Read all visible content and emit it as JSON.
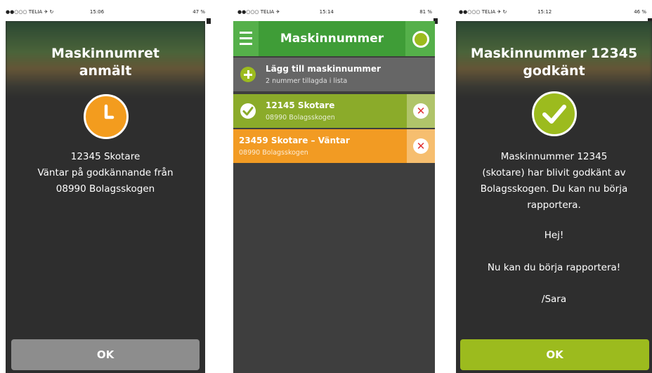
{
  "screens": [
    {
      "status": {
        "carrier": "●●○○○ TELIA ✈ ↻",
        "time": "15:06",
        "battery": "47 %"
      },
      "title_line1": "Maskinnumret",
      "title_line2": "anmält",
      "icon": "clock-icon",
      "lines": [
        "12345 Skotare",
        "Väntar på godkännande från",
        "08990 Bolagsskogen"
      ],
      "button": "OK"
    },
    {
      "status": {
        "carrier": "●●○○○ TELIA ✈",
        "time": "15:14",
        "battery": "81 %"
      },
      "header_title": "Maskinnummer",
      "add_row": {
        "title": "Lägg till maskinnummer",
        "subtitle": "2 nummer tillagda i lista"
      },
      "items": [
        {
          "title": "12145 Skotare",
          "subtitle": "08990 Bolagsskogen",
          "state": "approved"
        },
        {
          "title": "23459 Skotare – Väntar",
          "subtitle": "08990 Bolagsskogen",
          "state": "waiting"
        }
      ]
    },
    {
      "status": {
        "carrier": "●●○○○ TELIA ✈ ↻",
        "time": "15:12",
        "battery": "46 %"
      },
      "title_line1": "Maskinnummer 12345",
      "title_line2": "godkänt",
      "icon": "check-icon",
      "lines": [
        "Maskinnummer 12345",
        "(skotare) har blivit godkänt av",
        "Bolagsskogen. Du kan nu börja",
        "rapportera."
      ],
      "greeting": "Hej!",
      "message": "Nu kan du börja rapportera!",
      "signature": "/Sara",
      "button": "OK"
    }
  ],
  "colors": {
    "green": "#3f9d37",
    "lime": "#9cbb1e",
    "orange": "#f39c1e",
    "dark": "#2e2e2e"
  }
}
